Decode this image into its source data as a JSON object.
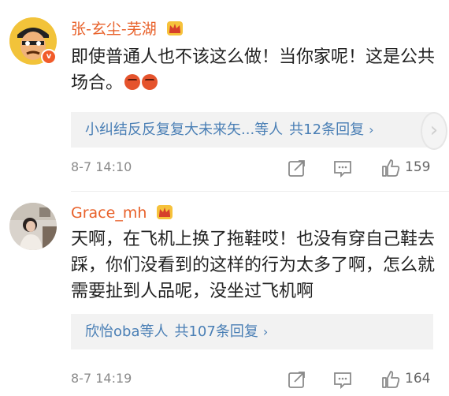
{
  "comments": [
    {
      "username": "张-玄尘-芜湖",
      "verified_badge": "v",
      "content_text": "即使普通人也不该这么做！当你家呢！这是公共场合。",
      "content_emojis": [
        "angry-face",
        "angry-face"
      ],
      "replies_names": "小纠结反反复复大未来矢...等人",
      "replies_count": "共12条回复",
      "replies_chevron": "›",
      "time": "8-7 14:10",
      "likes": "159"
    },
    {
      "username": "Grace_mh",
      "content_text": "天啊，在飞机上换了拖鞋哎！也没有穿自己鞋去踩，你们没看到的这样的行为太多了啊，怎么就需要扯到人品呢，没坐过飞机啊",
      "replies_names": "欣怡oba等人",
      "replies_count": "共107条回复",
      "replies_chevron": "›",
      "time": "8-7 14:19",
      "likes": "164"
    }
  ],
  "scroll_hint_glyph": "›",
  "colors": {
    "username": "#e8612a",
    "reply_link": "#4a7fb5",
    "meta": "#8a8a8a",
    "reply_box_bg": "#f2f2f2"
  },
  "icons": [
    "crown-icon",
    "verified-badge-icon",
    "angry-face-emoji",
    "share-icon",
    "comment-icon",
    "like-icon",
    "chevron-right-icon"
  ]
}
